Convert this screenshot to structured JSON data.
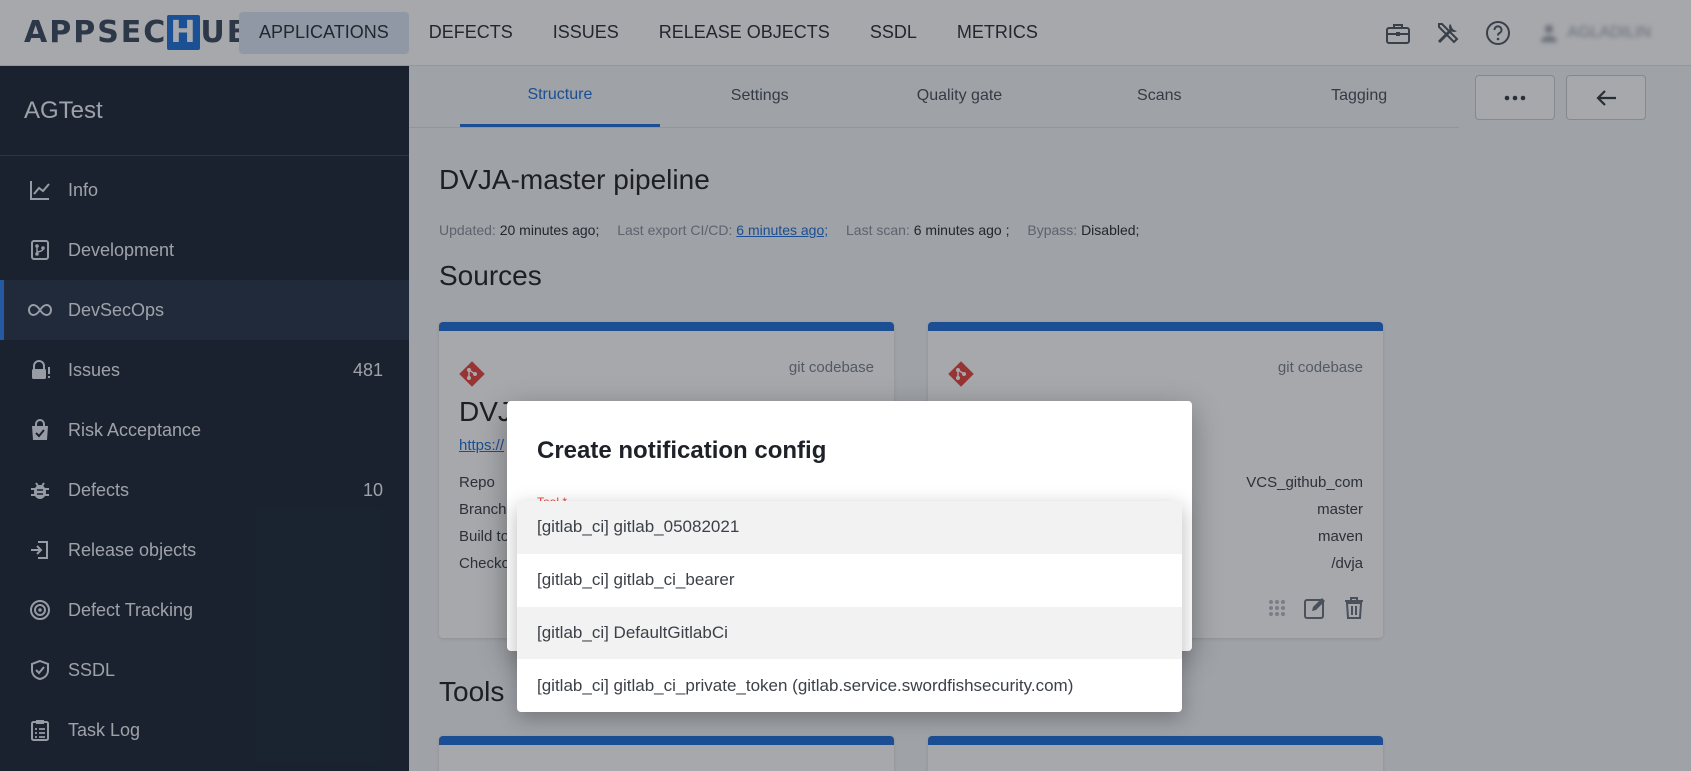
{
  "header": {
    "logo": {
      "pre": "APPSEC",
      "mark": "H",
      "post": "UB"
    },
    "nav": [
      "APPLICATIONS",
      "DEFECTS",
      "ISSUES",
      "RELEASE OBJECTS",
      "SSDL",
      "METRICS"
    ],
    "user": "AGLADILIN"
  },
  "sidebar": {
    "title": "AGTest",
    "items": [
      {
        "label": "Info",
        "icon": "chart-line-icon",
        "count": ""
      },
      {
        "label": "Development",
        "icon": "source-branch-icon",
        "count": ""
      },
      {
        "label": "DevSecOps",
        "icon": "infinity-icon",
        "count": ""
      },
      {
        "label": "Issues",
        "icon": "lock-alert-icon",
        "count": "481"
      },
      {
        "label": "Risk Acceptance",
        "icon": "shopping-check-icon",
        "count": ""
      },
      {
        "label": "Defects",
        "icon": "bug-icon",
        "count": "10"
      },
      {
        "label": "Release objects",
        "icon": "login-arrow-icon",
        "count": ""
      },
      {
        "label": "Defect Tracking",
        "icon": "radar-icon",
        "count": ""
      },
      {
        "label": "SSDL",
        "icon": "shield-check-icon",
        "count": ""
      },
      {
        "label": "Task Log",
        "icon": "clipboard-list-icon",
        "count": ""
      }
    ]
  },
  "tabs": [
    "Structure",
    "Settings",
    "Quality gate",
    "Scans",
    "Tagging"
  ],
  "pipeline": {
    "title": "DVJA-master pipeline",
    "updated_label": "Updated:",
    "updated_value": "20 minutes ago;",
    "export_label": "Last export CI/CD:",
    "export_value": "6 minutes ago;",
    "scan_label": "Last scan:",
    "scan_value": "6 minutes ago ;",
    "bypass_label": "Bypass:",
    "bypass_value": "Disabled;"
  },
  "sources": {
    "title": "Sources",
    "cards": [
      {
        "kind": "git codebase",
        "name": "DVJA-mast",
        "url": "https://",
        "rows": [
          {
            "label": "Repo",
            "value": ""
          },
          {
            "label": "Branch",
            "value": ""
          },
          {
            "label": "Build to",
            "value": ""
          },
          {
            "label": "Checko",
            "value": ""
          }
        ]
      },
      {
        "kind": "git codebase",
        "name": "",
        "url": "",
        "rows": [
          {
            "label": "",
            "value": "VCS_github_com"
          },
          {
            "label": "",
            "value": "master"
          },
          {
            "label": "",
            "value": "maven"
          },
          {
            "label": "",
            "value": "/dvja"
          }
        ]
      }
    ]
  },
  "tools": {
    "title": "Tools"
  },
  "dialog": {
    "title": "Create notification config",
    "field_label": "Tool *",
    "options": [
      "[gitlab_ci] gitlab_05082021",
      "[gitlab_ci] gitlab_ci_bearer",
      "[gitlab_ci] DefaultGitlabCi",
      "[gitlab_ci] gitlab_ci_private_token (gitlab.service.swordfishsecurity.com)"
    ]
  },
  "colors": {
    "accent": "#1f6fd6",
    "sidebar": "#1d2838",
    "git": "#e8453c"
  }
}
